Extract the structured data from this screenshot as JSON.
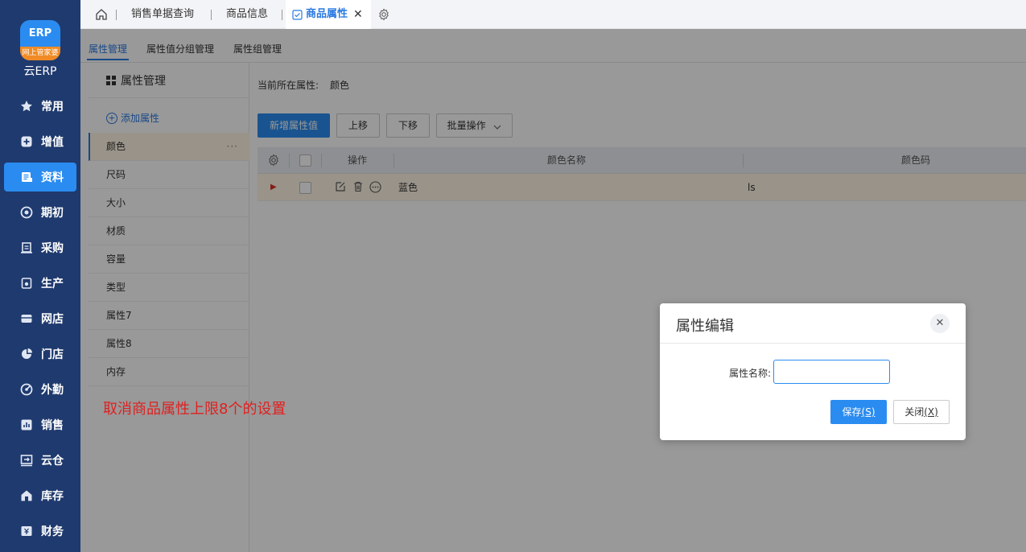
{
  "brand": {
    "logo_text": "ERP",
    "logo_ribbon": "网上管家婆",
    "name": "云ERP"
  },
  "nav": [
    {
      "label": "常用",
      "icon": "star-icon"
    },
    {
      "label": "增值",
      "icon": "plus-square-icon"
    },
    {
      "label": "资料",
      "icon": "document-icon",
      "active": true
    },
    {
      "label": "期初",
      "icon": "target-icon"
    },
    {
      "label": "采购",
      "icon": "purchase-icon"
    },
    {
      "label": "生产",
      "icon": "production-icon"
    },
    {
      "label": "网店",
      "icon": "shop-icon"
    },
    {
      "label": "门店",
      "icon": "pie-icon"
    },
    {
      "label": "外勤",
      "icon": "field-icon"
    },
    {
      "label": "销售",
      "icon": "chart-icon"
    },
    {
      "label": "云仓",
      "icon": "warehouse-icon"
    },
    {
      "label": "库存",
      "icon": "house-icon"
    },
    {
      "label": "财务",
      "icon": "finance-icon"
    }
  ],
  "top_tabs": {
    "t1": "销售单据查询",
    "t2": "商品信息",
    "t3": "商品属性"
  },
  "sub_tabs": {
    "s1": "属性管理",
    "s2": "属性值分组管理",
    "s3": "属性组管理"
  },
  "attr_panel": {
    "title": "属性管理",
    "add_label": "添加属性",
    "more": "···",
    "items": [
      "颜色",
      "尺码",
      "大小",
      "材质",
      "容量",
      "类型",
      "属性7",
      "属性8",
      "内存"
    ]
  },
  "note": "取消商品属性上限8个的设置",
  "main": {
    "current_label": "当前所在属性:",
    "current_value": "颜色",
    "buttons": {
      "add": "新增属性值",
      "up": "上移",
      "down": "下移",
      "batch": "批量操作"
    },
    "table": {
      "headers": {
        "op": "操作",
        "name": "颜色名称",
        "code": "颜色码"
      },
      "rows": [
        {
          "name": "蓝色",
          "code": "ls"
        }
      ]
    }
  },
  "dialog": {
    "title": "属性编辑",
    "close": "✕",
    "field_label": "属性名称:",
    "field_value": "",
    "save_label": "保存",
    "save_key": "(S)",
    "cancel_label": "关闭",
    "cancel_key": "(X)"
  },
  "colors": {
    "sidebar": "#1f3a6e",
    "accent": "#2a8cf0",
    "note": "#e02020",
    "row_highlight": "#fff6e5"
  }
}
